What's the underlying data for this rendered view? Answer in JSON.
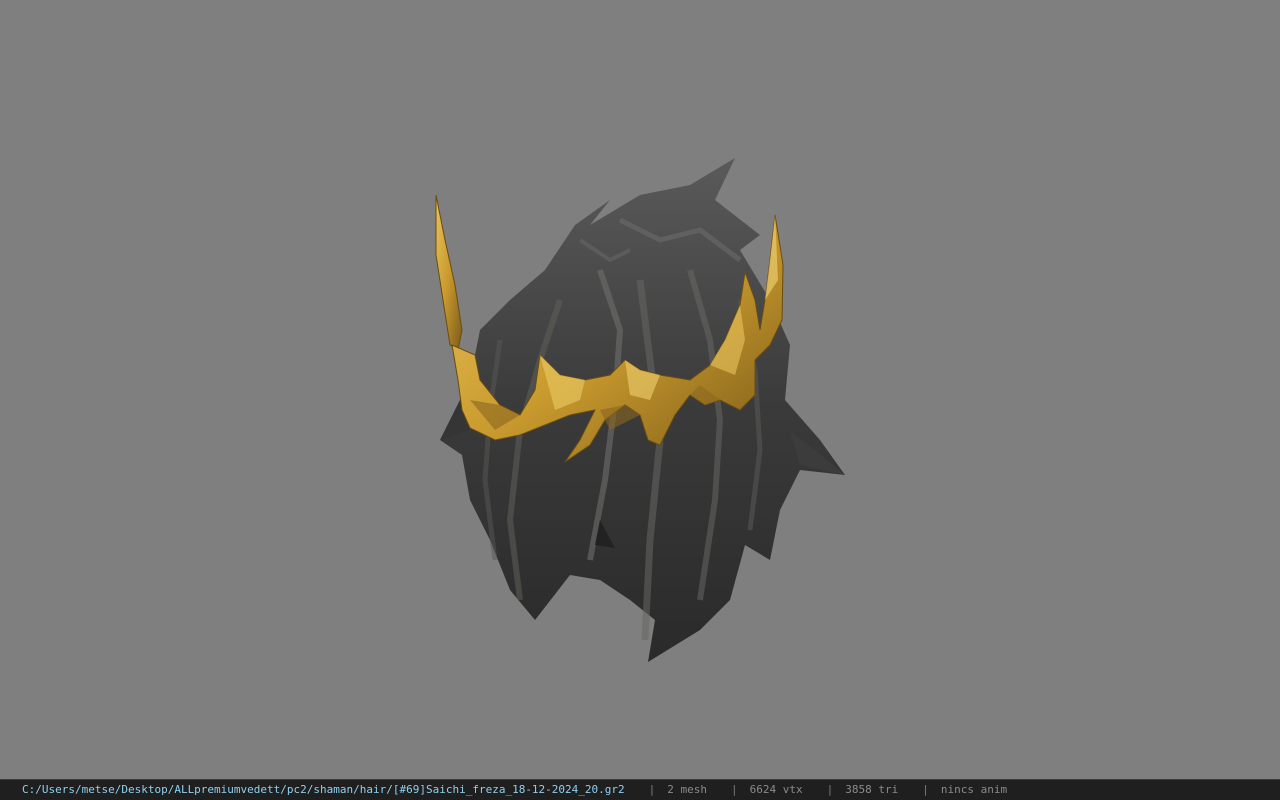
{
  "viewer": {
    "background_color": "#7f7f7f",
    "model": {
      "description_icon": "hair-with-gold-crown-model",
      "hair_color": "#3e3e3e",
      "crown_color": "#c9a23c"
    }
  },
  "statusbar": {
    "file_path": "C:/Users/metse/Desktop/ALLpremiumvedett/pc2/shaman/hair/[#69]Saichi_freza_18-12-2024_20.gr2",
    "separator": "|",
    "mesh_count": "2 mesh",
    "vertex_count": "6624 vtx",
    "triangle_count": "3858 tri",
    "animation_status": "nincs anim"
  }
}
